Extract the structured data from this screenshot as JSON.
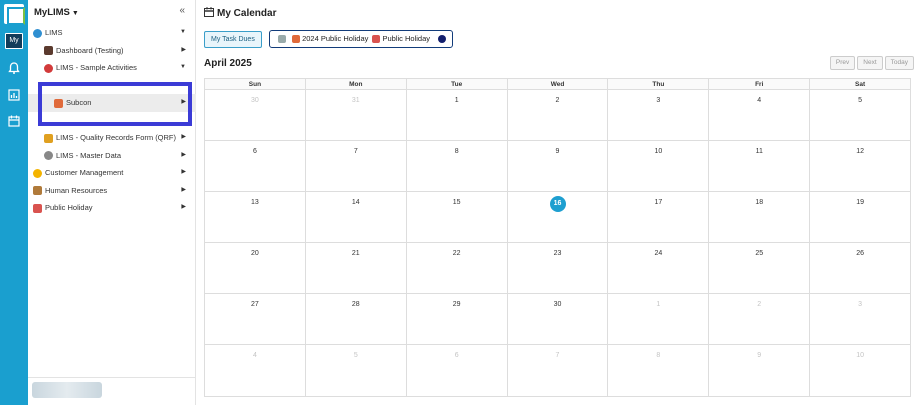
{
  "rail": {
    "my_label": "My"
  },
  "sidebar": {
    "title": "MyLIMS",
    "collapse_icon": "double-chevron-left-icon",
    "items": [
      {
        "label": "LIMS",
        "level": 0,
        "icon": "globe-icon",
        "arrow": "down"
      },
      {
        "label": "Dashboard (Testing)",
        "level": 1,
        "icon": "user-icon",
        "arrow": "right"
      },
      {
        "label": "LIMS - Sample Activities",
        "level": 1,
        "icon": "flask-icon",
        "arrow": "down"
      },
      {
        "label": "Subcon",
        "level": 2,
        "icon": "person-icon",
        "arrow": "right",
        "active": true
      },
      {
        "label": "LIMS - Quality Records Form (QRF)",
        "level": 1,
        "icon": "badge-icon",
        "arrow": "right"
      },
      {
        "label": "LIMS - Master Data",
        "level": 1,
        "icon": "gear-icon",
        "arrow": "right"
      },
      {
        "label": "Customer Management",
        "level": 0,
        "icon": "smiley-icon",
        "arrow": "right"
      },
      {
        "label": "Human Resources",
        "level": 0,
        "icon": "people-icon",
        "arrow": "right"
      },
      {
        "label": "Public Holiday",
        "level": 0,
        "icon": "calendar-icon",
        "arrow": "right"
      }
    ]
  },
  "main": {
    "title": "My Calendar",
    "task_button": "My Task Dues",
    "filter": {
      "item1": "2024 Public Holiday",
      "item2": "Public Holiday",
      "dot_color": "#131f6d"
    },
    "month": "April 2025",
    "nav": {
      "prev": "Prev",
      "next": "Next",
      "today": "Today"
    },
    "weekdays": [
      "Sun",
      "Mon",
      "Tue",
      "Wed",
      "Thu",
      "Fri",
      "Sat"
    ],
    "weeks": [
      [
        {
          "d": "30",
          "m": true
        },
        {
          "d": "31",
          "m": true
        },
        {
          "d": "1"
        },
        {
          "d": "2"
        },
        {
          "d": "3"
        },
        {
          "d": "4"
        },
        {
          "d": "5"
        }
      ],
      [
        {
          "d": "6"
        },
        {
          "d": "7"
        },
        {
          "d": "8"
        },
        {
          "d": "9"
        },
        {
          "d": "10"
        },
        {
          "d": "11"
        },
        {
          "d": "12"
        }
      ],
      [
        {
          "d": "13"
        },
        {
          "d": "14"
        },
        {
          "d": "15"
        },
        {
          "d": "16",
          "t": true
        },
        {
          "d": "17"
        },
        {
          "d": "18"
        },
        {
          "d": "19"
        }
      ],
      [
        {
          "d": "20"
        },
        {
          "d": "21"
        },
        {
          "d": "22"
        },
        {
          "d": "23"
        },
        {
          "d": "24"
        },
        {
          "d": "25"
        },
        {
          "d": "26"
        }
      ],
      [
        {
          "d": "27"
        },
        {
          "d": "28"
        },
        {
          "d": "29"
        },
        {
          "d": "30"
        },
        {
          "d": "1",
          "m": true
        },
        {
          "d": "2",
          "m": true
        },
        {
          "d": "3",
          "m": true
        }
      ],
      [
        {
          "d": "4",
          "m": true
        },
        {
          "d": "5",
          "m": true
        },
        {
          "d": "6",
          "m": true
        },
        {
          "d": "7",
          "m": true
        },
        {
          "d": "8",
          "m": true
        },
        {
          "d": "9",
          "m": true
        },
        {
          "d": "10",
          "m": true
        }
      ]
    ],
    "accent": "#1e9fd0"
  }
}
